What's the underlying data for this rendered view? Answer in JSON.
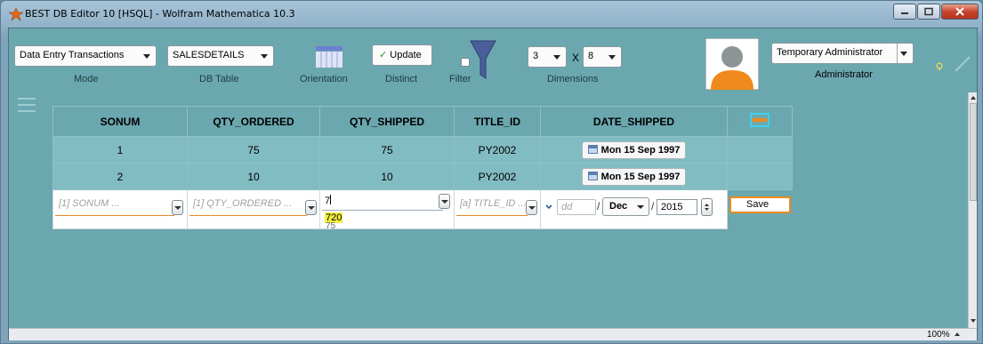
{
  "window": {
    "title": "BEST DB Editor 10 [HSQL] - Wolfram Mathematica 10.3"
  },
  "toolbar": {
    "mode_value": "Data Entry Transactions",
    "mode_label": "Mode",
    "table_value": "SALESDETAILS",
    "table_label": "DB Table",
    "orientation_label": "Orientation",
    "update_label": "Update",
    "distinct_label": "Distinct",
    "filter_label": "Filter",
    "rows_value": "3",
    "x_label": "X",
    "cols_value": "8",
    "dimensions_label": "Dimensions",
    "user_value": "Temporary Administrator",
    "role_label": "Administrator"
  },
  "table": {
    "headers": [
      "SONUM",
      "QTY_ORDERED",
      "QTY_SHIPPED",
      "TITLE_ID",
      "DATE_SHIPPED"
    ],
    "rows": [
      {
        "sonum": "1",
        "qty_ordered": "75",
        "qty_shipped": "75",
        "title_id": "PY2002",
        "date_shipped": "Mon 15 Sep 1997"
      },
      {
        "sonum": "2",
        "qty_ordered": "10",
        "qty_shipped": "10",
        "title_id": "PY2002",
        "date_shipped": "Mon 15 Sep 1997"
      }
    ]
  },
  "entry": {
    "sonum_placeholder": "[1] SONUM ...",
    "qty_ordered_placeholder": "[1] QTY_ORDERED ...",
    "qty_shipped_value": "7",
    "suggestion_1": "720",
    "suggestion_2": "75",
    "title_id_placeholder": "[a] TITLE_ID ...",
    "day_placeholder": "dd",
    "month_value": "Dec",
    "year_value": "2015",
    "save_label": "Save"
  },
  "status": {
    "zoom": "100%"
  },
  "colors": {
    "accent": "#e08a2a",
    "panel": "#6ba7af",
    "row": "#82bcc3"
  }
}
